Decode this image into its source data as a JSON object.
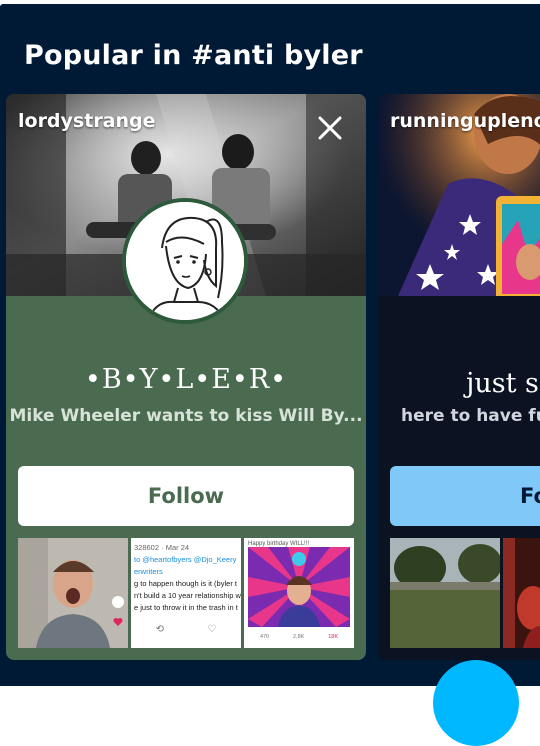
{
  "section": {
    "title": "Popular in #anti byler"
  },
  "cards": [
    {
      "blog": "lordystrange",
      "title": "•B•Y•L•E•R•",
      "description": "Mike Wheeler wants to kiss Will By...",
      "follow": "Follow",
      "accent": "#4a6b4f",
      "tweet": {
        "line1": "328602 · Mar 24",
        "line2": "to @heartofbyers @Djo_Keery",
        "line3": "erwriters",
        "line4": "g to happen though is it (byler t",
        "line5": "n't build a 10 year relationship w",
        "line6": "e just to throw it in the trash in t"
      },
      "post_caption": "Happy birthday WILL!!!",
      "post_counts": {
        "reply": "470",
        "retweet": "2,8K",
        "like": "18K"
      }
    },
    {
      "blog": "runninguplenor",
      "title": "just so",
      "description": "here to have fun",
      "follow": "Fo",
      "accent": "#7fc8f8"
    }
  ]
}
